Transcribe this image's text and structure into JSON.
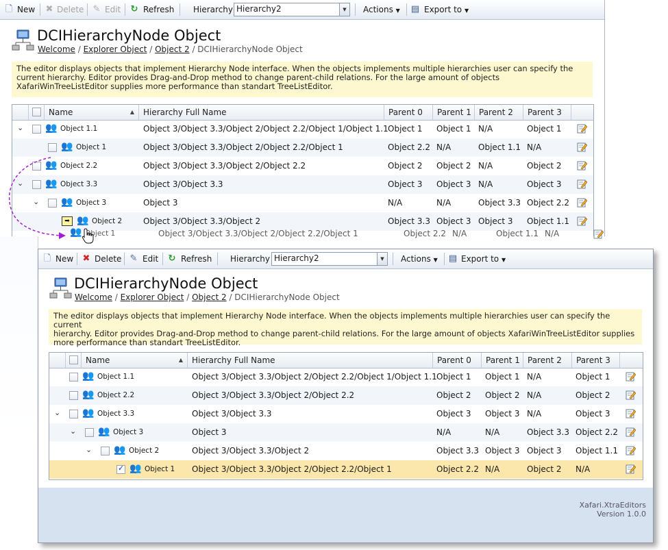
{
  "toolbar": {
    "new": "New",
    "delete": "Delete",
    "edit": "Edit",
    "refresh": "Refresh",
    "hierarchy_label": "Hierarchy",
    "hierarchy_value": "Hierarchy2",
    "actions": "Actions",
    "export": "Export to"
  },
  "page": {
    "title": "DCIHierarchyNode Object",
    "crumbs": [
      "Welcome",
      "Explorer Object",
      "Object 2",
      "DCIHierarchyNode Object"
    ],
    "info": "The editor displays objects that implement Hierarchy Node interface. When the objects implements multiple hierarchies user can specify the current hierarchy. Editor provides Drag-and-Drop method to change parent-child relations. For the large amount of objects XafariWinTreeListEditor supplies more performance than standart TreeListEditor.",
    "info_lines_back": [
      "The editor displays objects that implement Hierarchy Node interface. When the objects implements multiple hierarchies user can specify the",
      "current hierarchy. Editor provides Drag-and-Drop method to change parent-child relations. For the large amount of objects",
      "XafariWinTreeListEditor supplies more performance than standart TreeListEditor."
    ],
    "info_lines_front": [
      "The editor displays objects that implement Hierarchy Node interface. When the objects implements multiple hierarchies user can specify the current",
      "hierarchy. Editor provides Drag-and-Drop method to change parent-child relations. For the large amount of objects XafariWinTreeListEditor supplies",
      "more performance than standart TreeListEditor."
    ]
  },
  "columns": [
    "Name",
    "Hierarchy Full Name",
    "Parent 0",
    "Parent 1",
    "Parent 2",
    "Parent 3"
  ],
  "back_rows": [
    {
      "name": "Object 1.1",
      "full": "Object 3/Object 3.3/Object 2/Object 2.2/Object 1/Object 1.1",
      "p0": "Object 1",
      "p1": "Object 1",
      "p2": "N/A",
      "p3": "Object 1"
    },
    {
      "name": "Object 1",
      "full": "Object 3/Object 3.3/Object 2/Object 2.2/Object 1",
      "p0": "Object 2.2",
      "p1": "N/A",
      "p2": "Object 1.1",
      "p3": "N/A"
    },
    {
      "name": "Object 2.2",
      "full": "Object 3/Object 3.3/Object 2/Object 2.2",
      "p0": "Object 2",
      "p1": "Object 2",
      "p2": "N/A",
      "p3": "Object 2"
    },
    {
      "name": "Object 3.3",
      "full": "Object 3/Object 3.3",
      "p0": "Object 3",
      "p1": "Object 3",
      "p2": "N/A",
      "p3": "Object 3"
    },
    {
      "name": "Object 3",
      "full": "Object 3",
      "p0": "N/A",
      "p1": "N/A",
      "p2": "Object 3.3",
      "p3": "Object 2.2"
    },
    {
      "name": "Object 2",
      "full": "Object 3/Object 3.3/Object 2",
      "p0": "Object 3.3",
      "p1": "Object 3",
      "p2": "Object 3",
      "p3": "Object 1.1"
    }
  ],
  "drag_ghost": {
    "name": "Object 1",
    "full": "Object 3/Object 3.3/Object 2/Object 2.2/Object 1",
    "p0": "Object 2.2",
    "p1": "N/A",
    "p2": "Object 1.1",
    "p3": "N/A"
  },
  "front_rows": [
    {
      "name": "Object 1.1",
      "full": "Object 3/Object 3.3/Object 2/Object 2.2/Object 1/Object 1.1",
      "p0": "Object 1",
      "p1": "Object 1",
      "p2": "N/A",
      "p3": "Object 1"
    },
    {
      "name": "Object 2.2",
      "full": "Object 3/Object 3.3/Object 2/Object 2.2",
      "p0": "Object 2",
      "p1": "Object 2",
      "p2": "N/A",
      "p3": "Object 2"
    },
    {
      "name": "Object 3.3",
      "full": "Object 3/Object 3.3",
      "p0": "Object 3",
      "p1": "Object 3",
      "p2": "N/A",
      "p3": "Object 3"
    },
    {
      "name": "Object 3",
      "full": "Object 3",
      "p0": "N/A",
      "p1": "N/A",
      "p2": "Object 3.3",
      "p3": "Object 2.2"
    },
    {
      "name": "Object 2",
      "full": "Object 3/Object 3.3/Object 2",
      "p0": "Object 3.3",
      "p1": "Object 3",
      "p2": "Object 3",
      "p3": "Object 1.1"
    },
    {
      "name": "Object 1",
      "full": "Object 3/Object 3.3/Object 2/Object 2.2/Object 1",
      "p0": "Object 2.2",
      "p1": "N/A",
      "p2": "Object 2",
      "p3": "N/A"
    }
  ],
  "footer": {
    "line1": "Xafari.XtraEditors",
    "line2": "Version 1.0.0"
  },
  "colors": {
    "selected_row": "#fbe7ab",
    "info_bg": "#fdf8cf",
    "footer_bg": "#d7e2f1",
    "drag_arrow": "#a21fd1"
  }
}
